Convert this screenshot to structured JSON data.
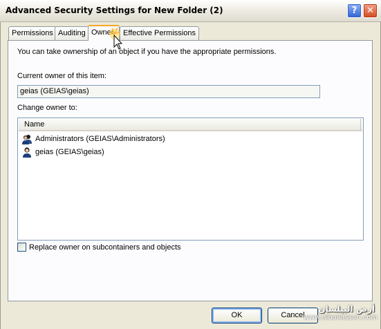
{
  "window": {
    "title": "Advanced Security Settings for New Folder (2)",
    "help_glyph": "?",
    "close_glyph": "✕"
  },
  "tabs": [
    {
      "label": "Permissions",
      "active": false
    },
    {
      "label": "Auditing",
      "active": false
    },
    {
      "label": "Owner",
      "active": true
    },
    {
      "label": "Effective Permissions",
      "active": false
    }
  ],
  "owner_tab": {
    "intro_text": "You can take ownership of an object if you have the appropriate permissions.",
    "current_owner_label": "Current owner of this item:",
    "current_owner_value": "geias (GEIAS\\geias)",
    "change_owner_label": "Change owner to:",
    "list": {
      "column_header": "Name",
      "items": [
        {
          "name": "Administrators (GEIAS\\Administrators)",
          "icon": "user-group-icon"
        },
        {
          "name": "geias (GEIAS\\geias)",
          "icon": "user-icon"
        }
      ]
    },
    "replace_checkbox": {
      "label": "Replace owner on subcontainers and objects",
      "checked": false
    }
  },
  "buttons": {
    "ok": "OK",
    "cancel": "Cancel"
  },
  "watermark": {
    "arabic": "أرض البيلسان",
    "url": "www.albailassan.com"
  },
  "colors": {
    "dialog_bg": "#ece9d8",
    "tab_active_accent": "#f5a627",
    "field_border": "#7f9db9"
  }
}
